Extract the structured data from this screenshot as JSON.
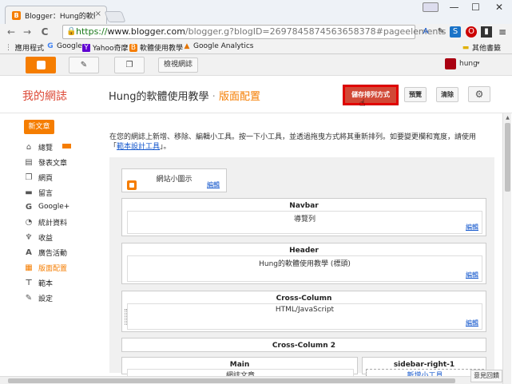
{
  "browser": {
    "tab_title": "Blogger：Hung的軟體使",
    "tab_close": "×",
    "window_buttons": {
      "minimize": "—",
      "maximize": "☐",
      "close": "✕"
    },
    "url_scheme": "https://",
    "url_host": "www.blogger.com",
    "url_path": "/blogger.g?blogID=2697845874563658378#pageelements",
    "back": "←",
    "forward": "→",
    "reload": "C",
    "star": "☆",
    "menu": "≡"
  },
  "bookmarks": {
    "items": [
      {
        "label": "應用程式",
        "icon": "apps-grid-icon"
      },
      {
        "label": "Google",
        "icon": "google-icon"
      },
      {
        "label": "Yahoo奇摩",
        "icon": "yahoo-icon"
      },
      {
        "label": "軟體使用教學",
        "icon": "blogger-icon"
      },
      {
        "label": "Google Analytics",
        "icon": "analytics-icon"
      }
    ],
    "other": "其他書籤"
  },
  "blogger_top": {
    "view_blog": "檢視網誌",
    "user": "hung",
    "caret": "▾"
  },
  "header": {
    "blog_name": "我的網誌",
    "page_title": "Hung的軟體使用教學",
    "separator": "·",
    "subtitle": "版面配置",
    "save_label": "儲存排列方式",
    "preview_label": "預覽",
    "clear_label": "清除",
    "gear": "⚙"
  },
  "sidebar": {
    "new_post": "新文章",
    "items": [
      {
        "label": "總覽",
        "icon": "home-icon",
        "glyph": "⌂"
      },
      {
        "label": "發表文章",
        "icon": "posts-icon",
        "glyph": "▤"
      },
      {
        "label": "網頁",
        "icon": "pages-icon",
        "glyph": "❐"
      },
      {
        "label": "留言",
        "icon": "comment-icon",
        "glyph": "▬"
      },
      {
        "label": "Google+",
        "icon": "google-plus-icon",
        "glyph": "G"
      },
      {
        "label": "統計資料",
        "icon": "stats-icon",
        "glyph": "◔"
      },
      {
        "label": "收益",
        "icon": "earnings-icon",
        "glyph": "♆"
      },
      {
        "label": "廣告活動",
        "icon": "campaigns-icon",
        "glyph": "A"
      },
      {
        "label": "版面配置",
        "icon": "layout-icon",
        "glyph": "▦",
        "active": true
      },
      {
        "label": "範本",
        "icon": "template-icon",
        "glyph": "⊤"
      },
      {
        "label": "設定",
        "icon": "settings-wrench-icon",
        "glyph": "✎"
      }
    ]
  },
  "main": {
    "desc_text": "在您的網誌上新增、移除、編輯小工具。按一下小工具，並透過拖曳方式將其重新排列。如要變更欄和寬度，請使用「",
    "desc_link": "範本設計工具",
    "desc_end": "」。",
    "edit_label": "編輯",
    "favicon_widget": {
      "text": "網站小圖示",
      "edit": "編輯"
    },
    "sections": [
      {
        "title": "Navbar",
        "widget": "導覽列",
        "edit": "編輯"
      },
      {
        "title": "Header",
        "widget": "Hung的軟體使用教學 (標頭)",
        "edit": "編輯"
      },
      {
        "title": "Cross-Column",
        "widget": "HTML/JavaScript",
        "edit": "編輯"
      },
      {
        "title": "Cross-Column 2"
      },
      {
        "title": "Main",
        "widget": "網誌文章"
      },
      {
        "title": "sidebar-right-1",
        "widget": "新增小工具"
      }
    ]
  },
  "feedback": "意見回饋"
}
